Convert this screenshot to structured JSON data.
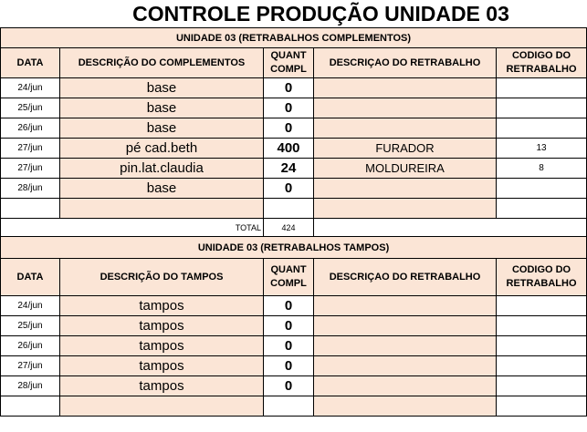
{
  "title": "CONTROLE PRODUÇÃO UNIDADE 03",
  "headers": {
    "data": "DATA",
    "quant": "QUANT COMPL",
    "desc_retrabalho": "DESCRIÇAO DO RETRABALHO",
    "codigo": "CODIGO DO RETRABALHO"
  },
  "section1": {
    "title": "UNIDADE 03 (RETRABALHOS COMPLEMENTOS)",
    "desc_header": "DESCRIÇÃO DO COMPLEMENTOS",
    "rows": [
      {
        "data": "24/jun",
        "desc": "base",
        "quant": "0",
        "retrabalho": "",
        "codigo": ""
      },
      {
        "data": "25/jun",
        "desc": "base",
        "quant": "0",
        "retrabalho": "",
        "codigo": ""
      },
      {
        "data": "26/jun",
        "desc": "base",
        "quant": "0",
        "retrabalho": "",
        "codigo": ""
      },
      {
        "data": "27/jun",
        "desc": "pé cad.beth",
        "quant": "400",
        "retrabalho": "FURADOR",
        "codigo": "13"
      },
      {
        "data": "27/jun",
        "desc": "pin.lat.claudia",
        "quant": "24",
        "retrabalho": "MOLDUREIRA",
        "codigo": "8"
      },
      {
        "data": "28/jun",
        "desc": "base",
        "quant": "0",
        "retrabalho": "",
        "codigo": ""
      },
      {
        "data": "",
        "desc": "",
        "quant": "",
        "retrabalho": "",
        "codigo": ""
      }
    ],
    "total_label": "TOTAL",
    "total": "424"
  },
  "section2": {
    "title": "UNIDADE 03 (RETRABALHOS TAMPOS)",
    "desc_header": "DESCRIÇÃO DO TAMPOS",
    "rows": [
      {
        "data": "24/jun",
        "desc": "tampos",
        "quant": "0",
        "retrabalho": "",
        "codigo": ""
      },
      {
        "data": "25/jun",
        "desc": "tampos",
        "quant": "0",
        "retrabalho": "",
        "codigo": ""
      },
      {
        "data": "26/jun",
        "desc": "tampos",
        "quant": "0",
        "retrabalho": "",
        "codigo": ""
      },
      {
        "data": "27/jun",
        "desc": "tampos",
        "quant": "0",
        "retrabalho": "",
        "codigo": ""
      },
      {
        "data": "28/jun",
        "desc": "tampos",
        "quant": "0",
        "retrabalho": "",
        "codigo": ""
      },
      {
        "data": "",
        "desc": "",
        "quant": "",
        "retrabalho": "",
        "codigo": ""
      }
    ]
  }
}
